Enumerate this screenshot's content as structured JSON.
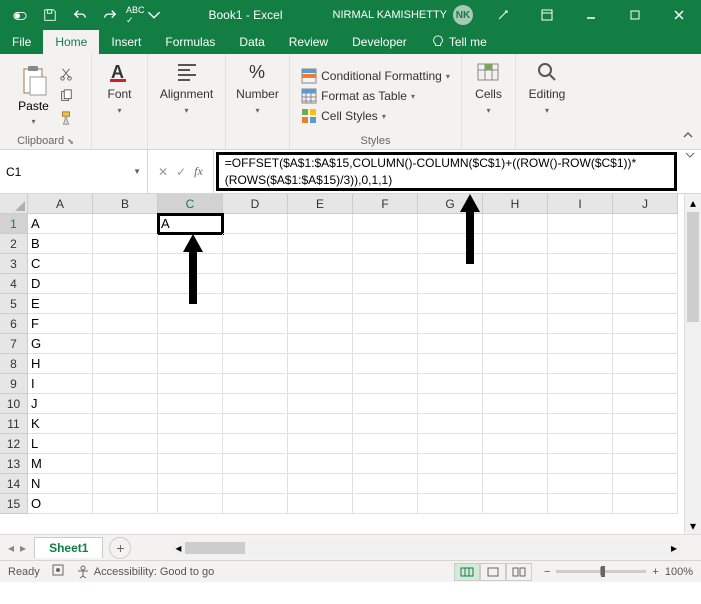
{
  "titlebar": {
    "title": "Book1 - Excel",
    "user_name": "NIRMAL KAMISHETTY",
    "user_initials": "NK"
  },
  "tabs": {
    "file": "File",
    "home": "Home",
    "insert": "Insert",
    "formulas": "Formulas",
    "data": "Data",
    "review": "Review",
    "developer": "Developer",
    "tellme": "Tell me"
  },
  "ribbon": {
    "clipboard": {
      "paste": "Paste",
      "label": "Clipboard"
    },
    "font": {
      "label": "Font"
    },
    "alignment": {
      "label": "Alignment"
    },
    "number": {
      "label": "Number"
    },
    "styles": {
      "cond_fmt": "Conditional Formatting",
      "table": "Format as Table",
      "cell_styles": "Cell Styles",
      "label": "Styles"
    },
    "cells": {
      "label": "Cells"
    },
    "editing": {
      "label": "Editing"
    }
  },
  "namebox": "C1",
  "formula": "=OFFSET($A$1:$A$15,COLUMN()-COLUMN($C$1)+((ROW()-ROW($C$1))*(ROWS($A$1:$A$15)/3)),0,1,1)",
  "columns": [
    "A",
    "B",
    "C",
    "D",
    "E",
    "F",
    "G",
    "H",
    "I",
    "J"
  ],
  "rows": [
    {
      "n": "1",
      "a": "A",
      "c": "A"
    },
    {
      "n": "2",
      "a": "B",
      "c": ""
    },
    {
      "n": "3",
      "a": "C",
      "c": ""
    },
    {
      "n": "4",
      "a": "D",
      "c": ""
    },
    {
      "n": "5",
      "a": "E",
      "c": ""
    },
    {
      "n": "6",
      "a": "F",
      "c": ""
    },
    {
      "n": "7",
      "a": "G",
      "c": ""
    },
    {
      "n": "8",
      "a": "H",
      "c": ""
    },
    {
      "n": "9",
      "a": "I",
      "c": ""
    },
    {
      "n": "10",
      "a": "J",
      "c": ""
    },
    {
      "n": "11",
      "a": "K",
      "c": ""
    },
    {
      "n": "12",
      "a": "L",
      "c": ""
    },
    {
      "n": "13",
      "a": "M",
      "c": ""
    },
    {
      "n": "14",
      "a": "N",
      "c": ""
    },
    {
      "n": "15",
      "a": "O",
      "c": ""
    }
  ],
  "sheet_tab": "Sheet1",
  "status": {
    "ready": "Ready",
    "accessibility": "Accessibility: Good to go",
    "zoom": "100%"
  }
}
